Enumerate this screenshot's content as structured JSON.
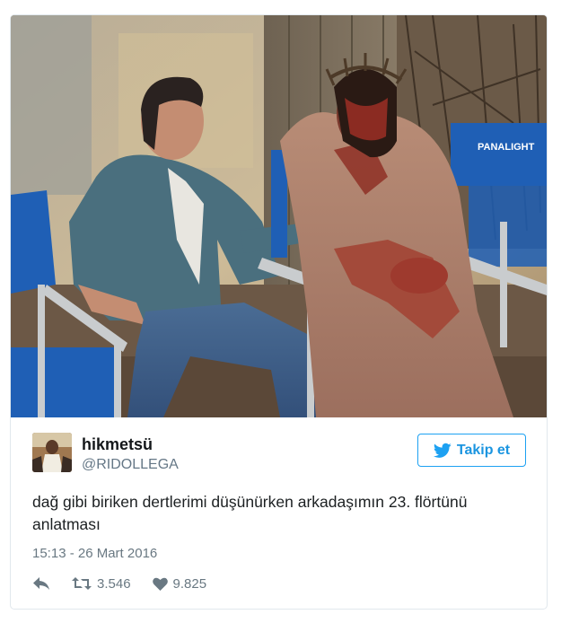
{
  "tweet": {
    "display_name": "hikmetsü",
    "handle": "@RIDOLLEGA",
    "follow_label": "Takip et",
    "text": "dağ gibi biriken dertlerimi düşünürken arkadaşımın 23. flörtünü anlatması",
    "timestamp": "15:13 - 26 Mart 2016",
    "retweet_count": "3.546",
    "like_count": "9.825"
  },
  "photo": {
    "chair_label": "PANALIGHT"
  },
  "icons": {
    "follow": "twitter-bird-icon",
    "reply": "reply-icon",
    "retweet": "retweet-icon",
    "like": "heart-icon"
  },
  "colors": {
    "accent": "#1da1f2",
    "text": "#1c2022",
    "muted": "#697882",
    "chair_blue": "#1f5fb5"
  }
}
